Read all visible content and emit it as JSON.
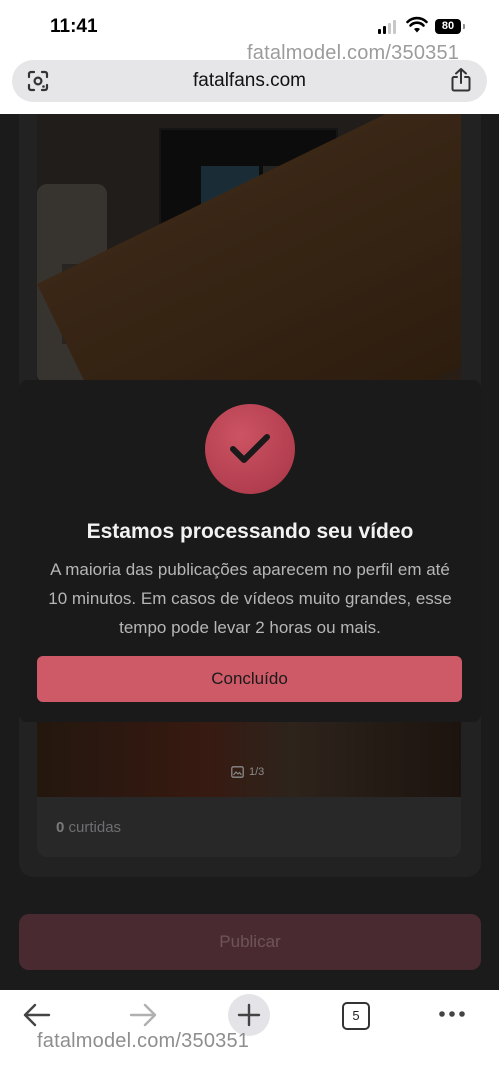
{
  "status_bar": {
    "time": "11:41",
    "battery": "80"
  },
  "watermark": {
    "text": "fatalmodel.com/350351"
  },
  "browser": {
    "url": "fatalfans.com",
    "open_tabs": "5"
  },
  "post": {
    "media_count": "1/3",
    "likes_count": "0",
    "likes_label": "curtidas"
  },
  "publish_label": "Publicar",
  "modal": {
    "title": "Estamos processando seu vídeo",
    "message": "A maioria das publicações aparecem no perfil em até 10 minutos. Em casos de vídeos muito grandes, esse tempo pode levar 2 horas ou mais.",
    "button_label": "Concluído",
    "accent_color": "#ce5a68"
  }
}
